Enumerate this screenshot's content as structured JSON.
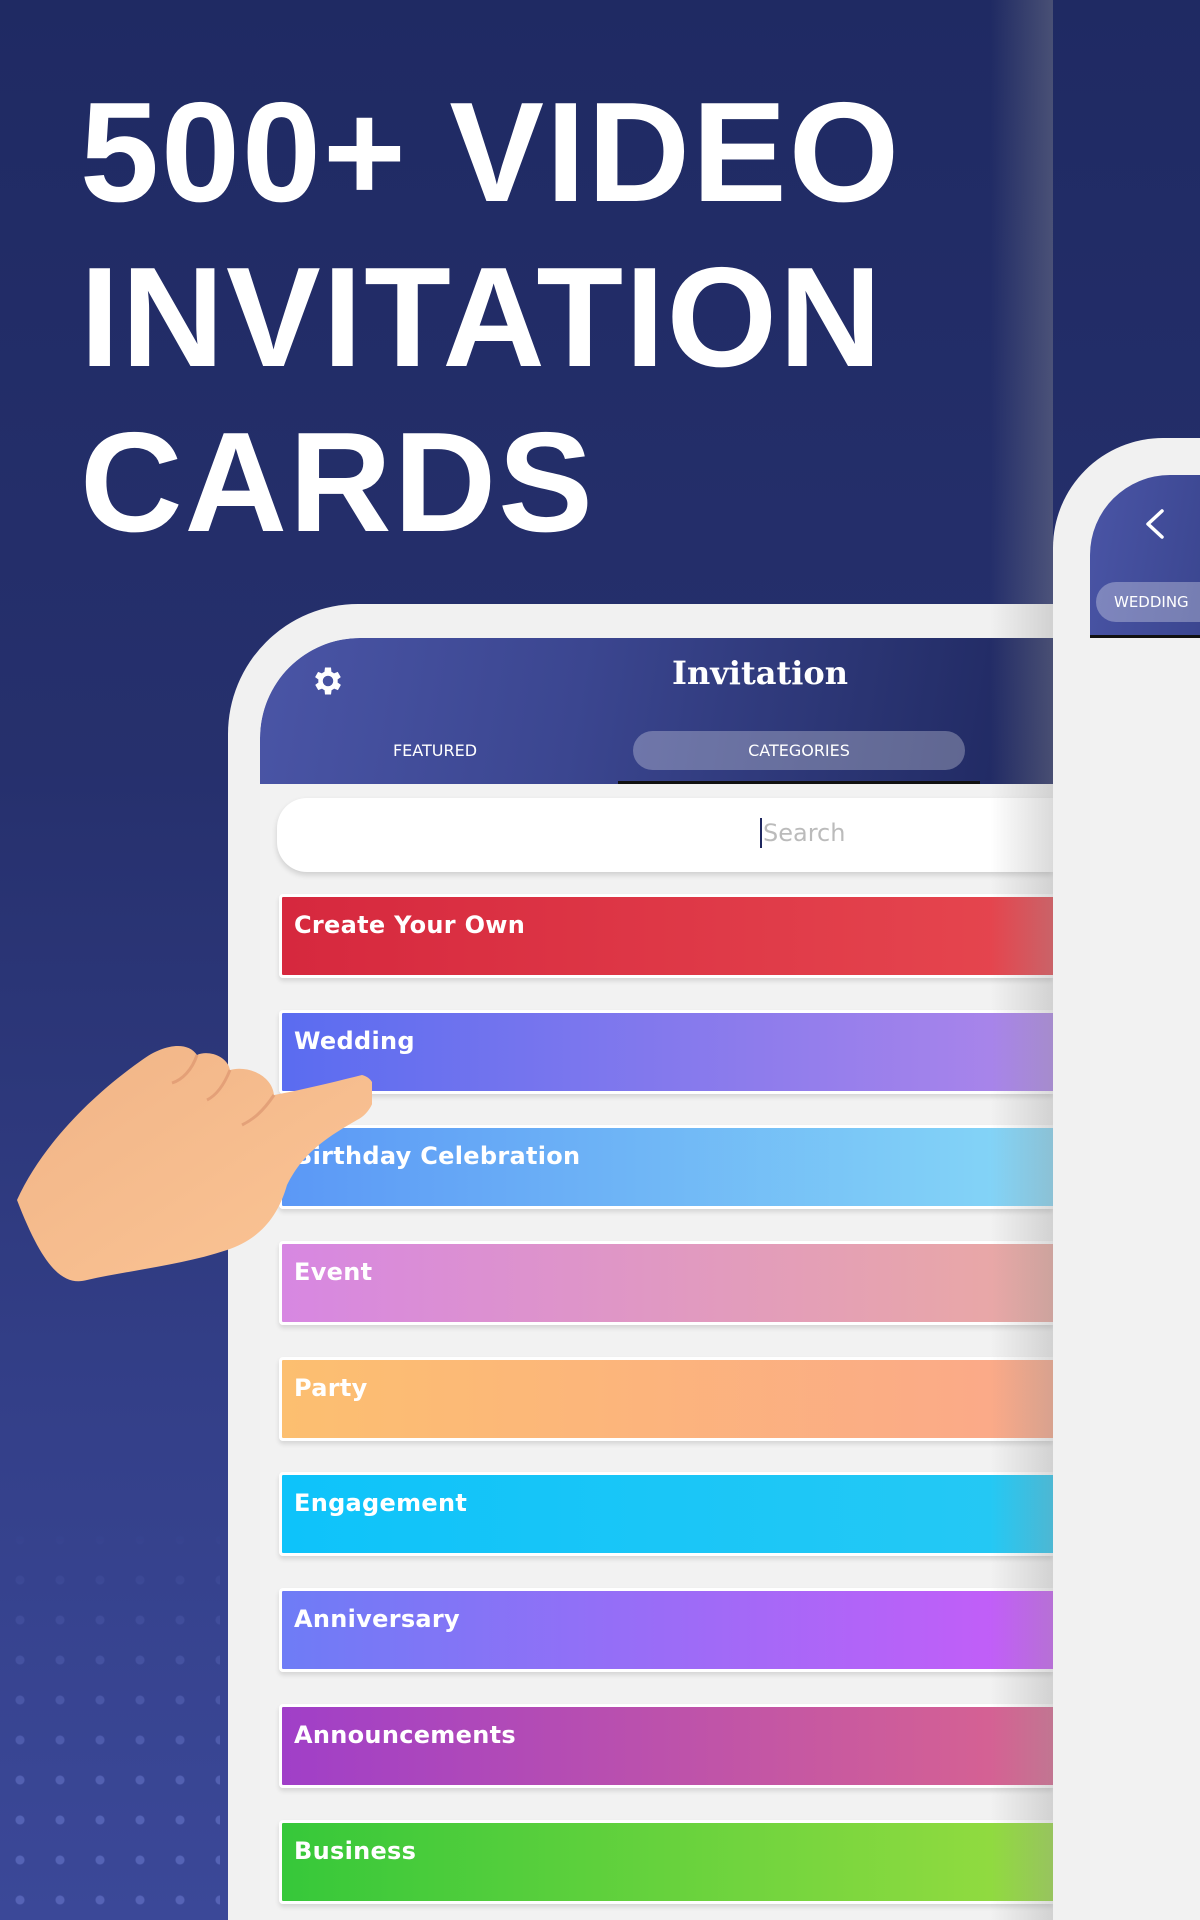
{
  "headline": {
    "line1": "500+ VIDEO",
    "line2": "INVITATION",
    "line3": "CARDS"
  },
  "app": {
    "title": "Invitation",
    "settings_icon": "gear-icon"
  },
  "tabs": {
    "featured": "FEATURED",
    "categories": "CATEGORIES",
    "active": "CATEGORIES"
  },
  "search": {
    "placeholder": "Search",
    "value": ""
  },
  "categories": [
    {
      "label": "Create Your Own",
      "colors": [
        "#d6283e",
        "#e6474f"
      ]
    },
    {
      "label": "Wedding",
      "colors": [
        "#5a6cf0",
        "#ae86ea"
      ]
    },
    {
      "label": "Birthday Celebration",
      "colors": [
        "#5b98f6",
        "#86d8f7"
      ]
    },
    {
      "label": "Event",
      "colors": [
        "#d787e2",
        "#eaaaa2"
      ]
    },
    {
      "label": "Party",
      "colors": [
        "#fcbf70",
        "#fba88a"
      ]
    },
    {
      "label": "Engagement",
      "colors": [
        "#0ec3fa",
        "#26c9f4"
      ]
    },
    {
      "label": "Anniversary",
      "colors": [
        "#6e7cf6",
        "#c85cf8"
      ]
    },
    {
      "label": "Announcements",
      "colors": [
        "#a03fc8",
        "#d9648f"
      ]
    },
    {
      "label": "Business",
      "colors": [
        "#36c83a",
        "#98dc40"
      ]
    }
  ],
  "second_screen": {
    "back_icon": "chevron-left-icon",
    "tab_partial": "WEDDING"
  }
}
